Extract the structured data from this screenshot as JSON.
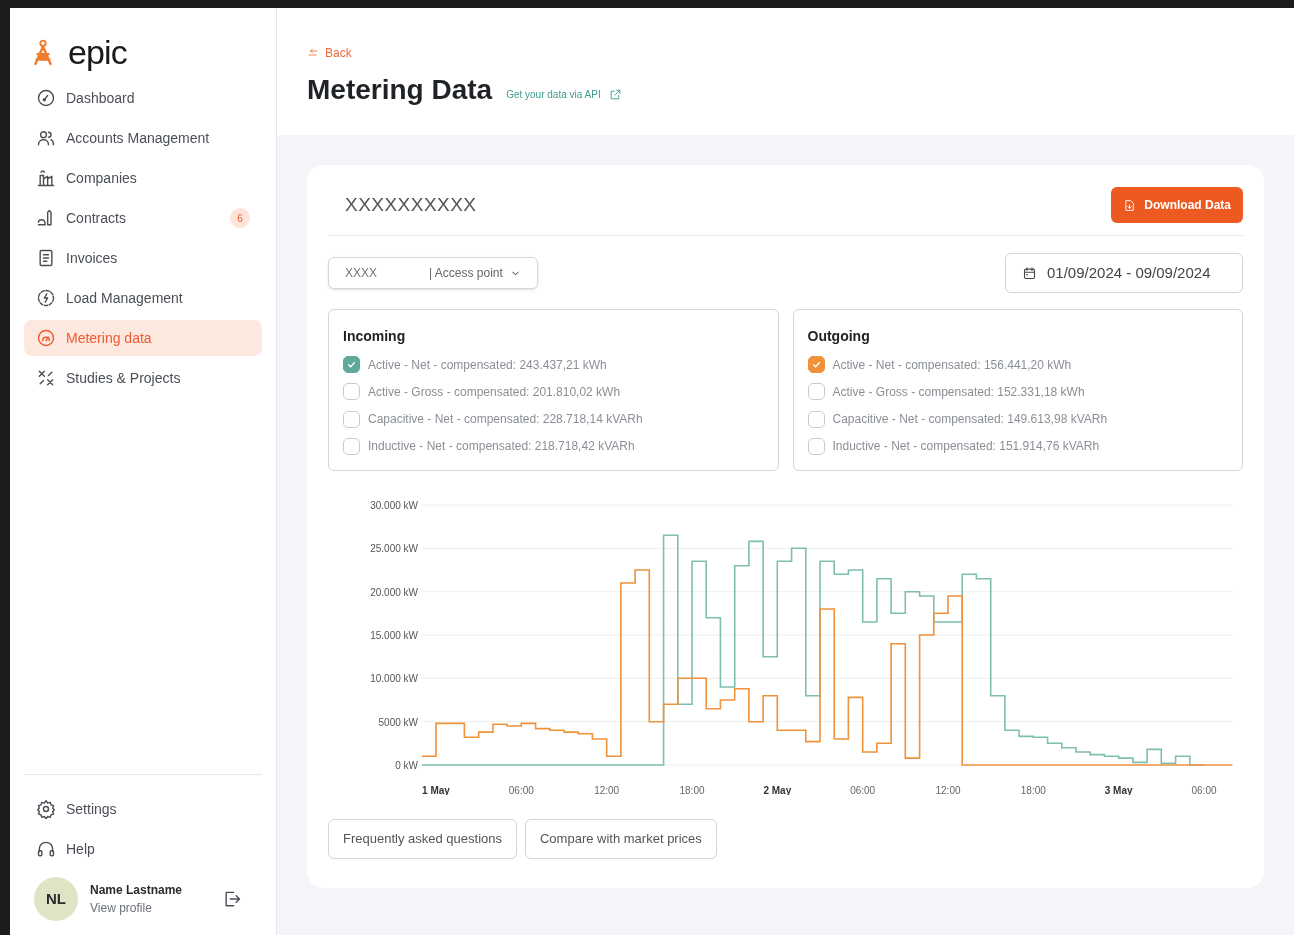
{
  "brand": {
    "name": "epic"
  },
  "sidebar": {
    "items": [
      {
        "label": "Dashboard",
        "selected": false
      },
      {
        "label": "Accounts Management",
        "selected": false
      },
      {
        "label": "Companies",
        "selected": false
      },
      {
        "label": "Contracts",
        "selected": false,
        "badge": "6"
      },
      {
        "label": "Invoices",
        "selected": false
      },
      {
        "label": "Load Management",
        "selected": false
      },
      {
        "label": "Metering data",
        "selected": true
      },
      {
        "label": "Studies & Projects",
        "selected": false
      }
    ],
    "footer_items": [
      {
        "label": "Settings"
      },
      {
        "label": "Help"
      }
    ],
    "user": {
      "initials": "NL",
      "name": "Name Lastname",
      "link": "View profile"
    }
  },
  "header": {
    "back": "Back",
    "title": "Metering Data",
    "api_link": "Get your data via API"
  },
  "card": {
    "title": "XXXXXXXXXX",
    "download_button": "Download Data",
    "access_point": {
      "value": "XXXX",
      "label": "| Access point"
    },
    "date_range": "01/09/2024 - 09/09/2024",
    "groups": [
      {
        "title": "Incoming",
        "color": "#5fa99b",
        "options": [
          {
            "label": "Active - Net - compensated: 243.437,21 kWh",
            "checked": true
          },
          {
            "label": "Active - Gross - compensated: 201.810,02 kWh",
            "checked": false
          },
          {
            "label": "Capacitive - Net - compensated: 228.718,14 kVARh",
            "checked": false
          },
          {
            "label": "Inductive - Net - compensated: 218.718,42 kVARh",
            "checked": false
          }
        ]
      },
      {
        "title": "Outgoing",
        "color": "#f0923a",
        "options": [
          {
            "label": "Active - Net - compensated: 156.441,20 kWh",
            "checked": true
          },
          {
            "label": "Active - Gross - compensated: 152.331,18 kWh",
            "checked": false
          },
          {
            "label": "Capacitive - Net - compensated: 149.613,98 kVARh",
            "checked": false
          },
          {
            "label": "Inductive - Net - compensated: 151.914,76 kVARh",
            "checked": false
          }
        ]
      }
    ],
    "chart_data": {
      "type": "line",
      "x": [
        -1,
        0,
        0,
        1,
        1,
        2,
        2,
        3,
        3,
        4,
        4,
        5,
        5,
        6,
        6,
        7,
        7,
        8,
        8,
        9,
        9,
        10,
        10,
        11,
        11,
        12,
        12,
        13,
        13,
        14,
        14,
        15,
        15,
        16,
        16,
        17,
        17,
        18,
        18,
        19,
        19,
        20,
        20,
        21,
        21,
        22,
        22,
        23,
        23,
        24,
        24,
        25,
        25,
        26,
        26,
        27,
        27,
        28,
        28,
        29,
        29,
        30,
        30,
        31,
        31,
        32,
        32,
        33,
        33,
        34,
        34,
        35,
        35,
        36,
        36,
        37,
        37,
        38,
        38,
        39,
        39,
        40,
        40,
        41,
        41,
        42,
        42,
        43,
        43,
        44,
        44,
        45,
        45,
        46,
        46,
        47,
        47,
        48,
        48,
        49,
        49,
        50,
        50,
        51,
        51,
        52,
        52,
        53,
        53,
        54,
        54,
        55,
        55,
        56
      ],
      "series": [
        {
          "color": "#7fbfb0",
          "values": [
            0,
            0,
            0,
            0,
            0,
            0,
            0,
            0,
            0,
            0,
            0,
            0,
            0,
            0,
            0,
            0,
            0,
            0,
            0,
            0,
            0,
            0,
            0,
            0,
            0,
            0,
            0,
            0,
            0,
            0,
            0,
            0,
            0,
            0,
            26500,
            26500,
            7000,
            7000,
            23500,
            23500,
            17000,
            17000,
            9000,
            9000,
            23000,
            23000,
            25800,
            25800,
            12500,
            12500,
            23500,
            23500,
            25000,
            25000,
            8000,
            8000,
            23500,
            23500,
            22000,
            22000,
            22500,
            22500,
            16500,
            16500,
            21500,
            21500,
            17500,
            17500,
            20000,
            20000,
            19500,
            19500,
            16500,
            16500,
            16500,
            16500,
            22000,
            22000,
            21500,
            21500,
            8000,
            8000,
            4000,
            4000,
            3300,
            3300,
            3200,
            3200,
            2500,
            2500,
            2000,
            2000,
            1500,
            1500,
            1200,
            1200,
            1000,
            1000,
            800,
            800,
            300,
            300,
            1800,
            1800,
            200,
            200,
            1000,
            1000,
            0,
            0,
            null,
            null,
            null,
            null
          ]
        },
        {
          "color": "#f0923a",
          "values": [
            1000,
            1000,
            4800,
            4800,
            4800,
            4800,
            3200,
            3200,
            3800,
            3800,
            4700,
            4700,
            4500,
            4500,
            4800,
            4800,
            4200,
            4200,
            4000,
            4000,
            3800,
            3800,
            3600,
            3600,
            3000,
            3000,
            1000,
            1000,
            21000,
            21000,
            22500,
            22500,
            5000,
            5000,
            7000,
            7000,
            10000,
            10000,
            10000,
            10000,
            6500,
            6500,
            7500,
            7500,
            8800,
            8800,
            5000,
            5000,
            8000,
            8000,
            4000,
            4000,
            4000,
            4000,
            2700,
            2700,
            18000,
            18000,
            3000,
            3000,
            7800,
            7800,
            1500,
            1500,
            2500,
            2500,
            14000,
            14000,
            800,
            800,
            15000,
            15000,
            17500,
            17500,
            19500,
            19500,
            0,
            0,
            0,
            0,
            0,
            0,
            0,
            0,
            0,
            0,
            0,
            0,
            0,
            0,
            0,
            0,
            0,
            0,
            0,
            0,
            0,
            0,
            0,
            0,
            0,
            0,
            0,
            0,
            0,
            0,
            0,
            0,
            0,
            0,
            0,
            0,
            0,
            0
          ]
        }
      ],
      "xticks": [
        {
          "value": 0,
          "label": "1 May"
        },
        {
          "value": 6,
          "label": "06:00"
        },
        {
          "value": 12,
          "label": "12:00"
        },
        {
          "value": 18,
          "label": "18:00"
        },
        {
          "value": 24,
          "label": "2 May"
        },
        {
          "value": 48,
          "label": "3 May"
        }
      ],
      "xlim": [
        -1,
        56
      ],
      "ylim": [
        0,
        30000
      ],
      "grid": true,
      "yticks": [
        {
          "value": 0,
          "label": "0 kW"
        },
        {
          "value": 5000,
          "label": "5000 kW"
        },
        {
          "value": 10000,
          "label": "10.000 kW"
        },
        {
          "value": 15000,
          "label": "15.000 kW"
        },
        {
          "value": 20000,
          "label": "20.000 kW"
        },
        {
          "value": 25000,
          "label": "25.000 kW"
        },
        {
          "value": 30000,
          "label": "30.000 kW"
        }
      ]
    },
    "time_axis_labels": [
      "06:00",
      "12:00",
      "18:00",
      "06:00"
    ],
    "footer_buttons": [
      "Frequently asked questions",
      "Compare with market prices"
    ]
  }
}
